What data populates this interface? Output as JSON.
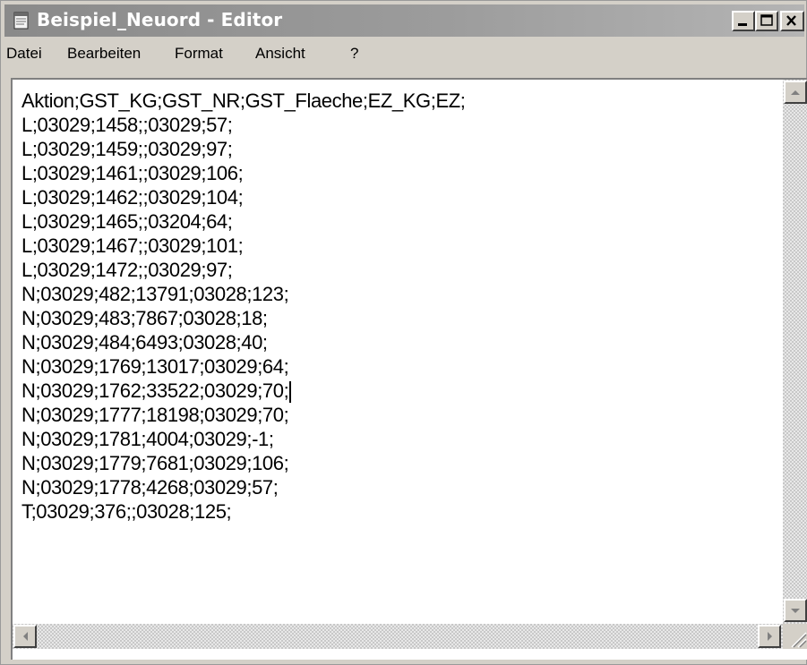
{
  "window": {
    "title": "Beispiel_Neuord - Editor"
  },
  "menu": {
    "items": [
      "Datei",
      "Bearbeiten",
      "Format",
      "Ansicht",
      "?"
    ]
  },
  "editor": {
    "lines": [
      "Aktion;GST_KG;GST_NR;GST_Flaeche;EZ_KG;EZ;",
      "L;03029;1458;;03029;57;",
      "L;03029;1459;;03029;97;",
      "L;03029;1461;;03029;106;",
      "L;03029;1462;;03029;104;",
      "L;03029;1465;;03204;64;",
      "L;03029;1467;;03029;101;",
      "L;03029;1472;;03029;97;",
      "N;03029;482;13791;03028;123;",
      "N;03029;483;7867;03028;18;",
      "N;03029;484;6493;03028;40;",
      "N;03029;1769;13017;03029;64;",
      "N;03029;1762;33522;03029;70;",
      "N;03029;1777;18198;03029;70;",
      "N;03029;1781;4004;03029;-1;",
      "N;03029;1779;7681;03029;106;",
      "N;03029;1778;4268;03029;57;",
      "T;03029;376;;03028;125;"
    ],
    "caret_line": 12
  },
  "icons": {
    "app": "notepad-icon",
    "minimize": "minimize-icon",
    "maximize": "maximize-icon",
    "close": "close-icon"
  },
  "colors": {
    "titlebar": "#8a8a8a",
    "window_bg": "#d4d0c8",
    "text_bg": "#ffffff"
  }
}
